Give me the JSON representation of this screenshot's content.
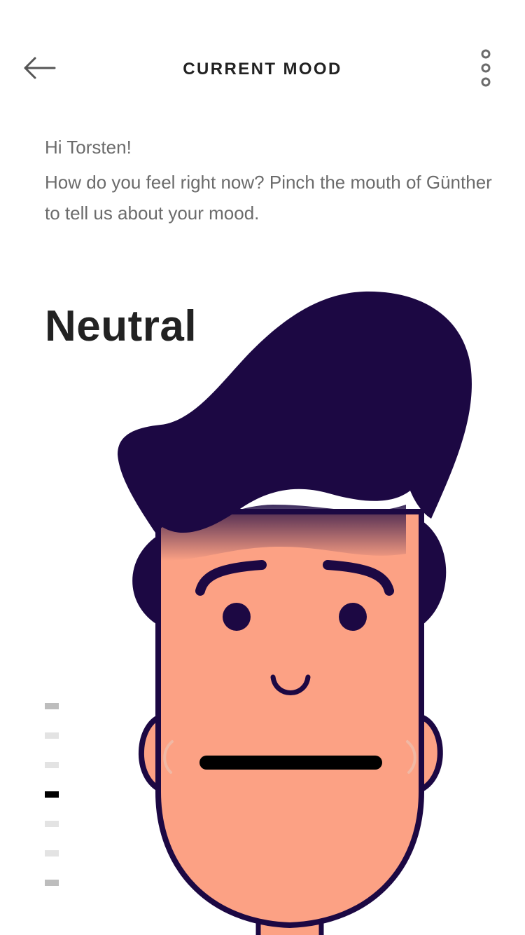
{
  "header": {
    "title": "CURRENT MOOD",
    "back_icon": "arrow-left-icon",
    "menu_icon": "more-vertical-icon"
  },
  "intro": {
    "greeting": "Hi Torsten!",
    "prompt": "How do you feel right now? Pinch the mouth of Günther to tell us about your mood."
  },
  "mood": {
    "label": "Neutral",
    "level_index": 3,
    "level_count": 7
  },
  "character": {
    "name": "Günther",
    "hair_color": "#1c0843",
    "skin_color": "#fca184",
    "mouth_color": "#000000"
  },
  "colors": {
    "title_text": "#222222",
    "body_text": "#6b6b6b",
    "scale_active": "#000000",
    "scale_end": "#bdbdbd",
    "scale_inactive": "#e3e3e3"
  }
}
